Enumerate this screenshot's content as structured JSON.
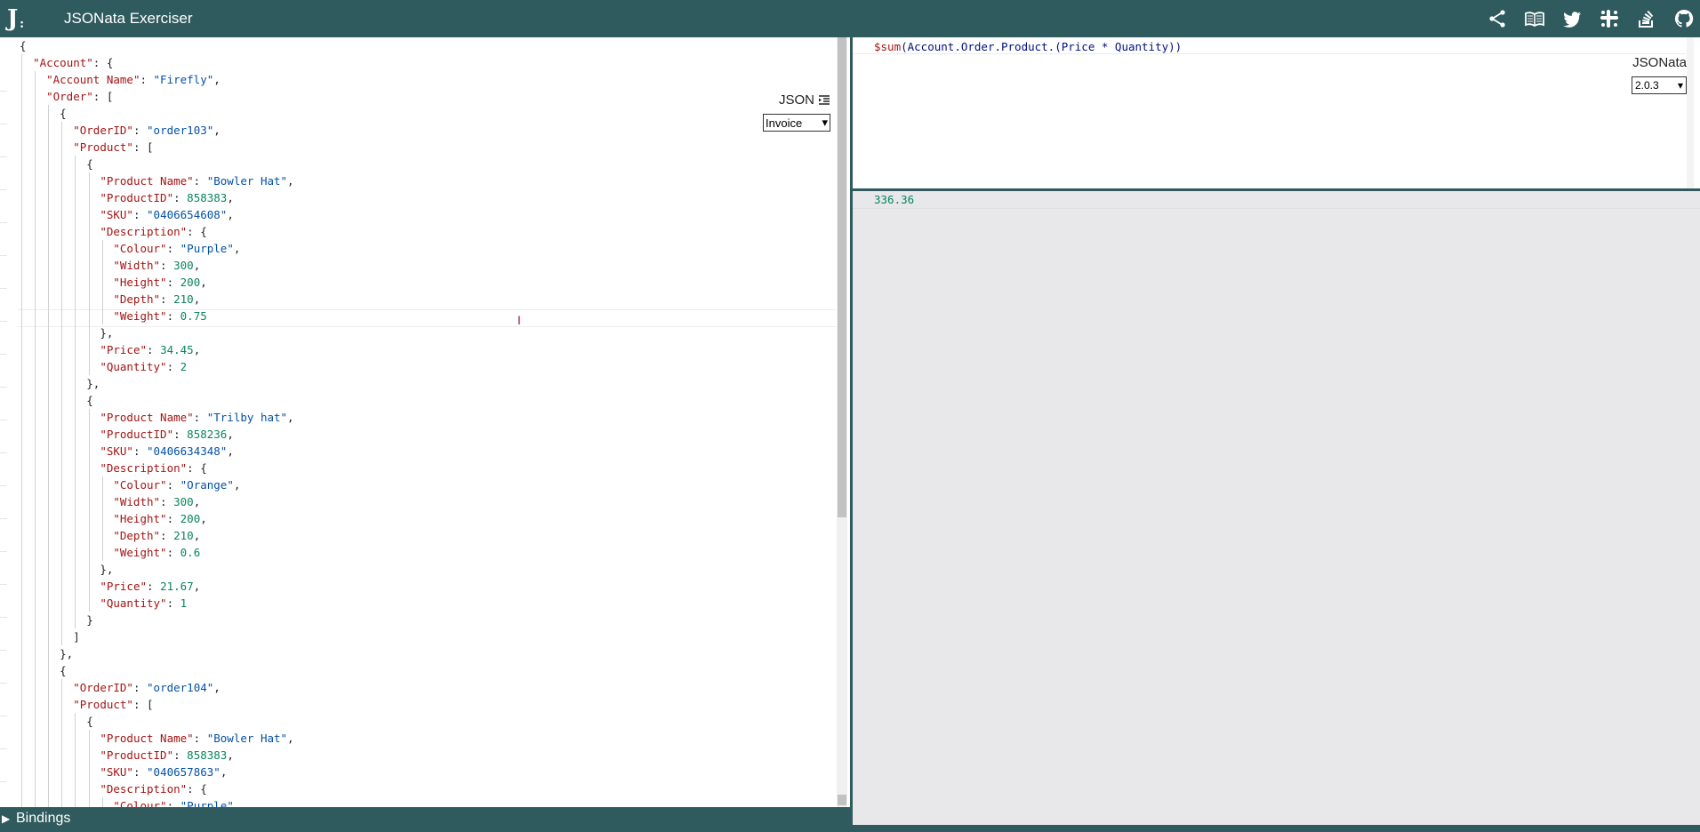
{
  "header": {
    "title": "JSONata Exerciser",
    "logo_letter": "J",
    "icons": [
      "share-icon",
      "book-icon",
      "twitter-icon",
      "slack-icon",
      "stackoverflow-icon",
      "github-icon"
    ]
  },
  "left_panel": {
    "label": "JSON",
    "sample_selected": "Invoice",
    "lines": [
      "{",
      "  \"Account\": {",
      "    \"Account Name\": \"Firefly\",",
      "    \"Order\": [",
      "      {",
      "        \"OrderID\": \"order103\",",
      "        \"Product\": [",
      "          {",
      "            \"Product Name\": \"Bowler Hat\",",
      "            \"ProductID\": 858383,",
      "            \"SKU\": \"0406654608\",",
      "            \"Description\": {",
      "              \"Colour\": \"Purple\",",
      "              \"Width\": 300,",
      "              \"Height\": 200,",
      "              \"Depth\": 210,",
      "              \"Weight\": 0.75",
      "            },",
      "            \"Price\": 34.45,",
      "            \"Quantity\": 2",
      "          },",
      "          {",
      "            \"Product Name\": \"Trilby hat\",",
      "            \"ProductID\": 858236,",
      "            \"SKU\": \"0406634348\",",
      "            \"Description\": {",
      "              \"Colour\": \"Orange\",",
      "              \"Width\": 300,",
      "              \"Height\": 200,",
      "              \"Depth\": 210,",
      "              \"Weight\": 0.6",
      "            },",
      "            \"Price\": 21.67,",
      "            \"Quantity\": 1",
      "          }",
      "        ]",
      "      },",
      "      {",
      "        \"OrderID\": \"order104\",",
      "        \"Product\": [",
      "          {",
      "            \"Product Name\": \"Bowler Hat\",",
      "            \"ProductID\": 858383,",
      "            \"SKU\": \"040657863\",",
      "            \"Description\": {",
      "              \"Colour\": \"Purple\","
    ]
  },
  "expression": {
    "fn": "$sum",
    "rest": "(Account.Order.Product.(Price * Quantity))",
    "label": "JSONata",
    "version_selected": "2.0.3"
  },
  "result": {
    "value": "336.36"
  },
  "bindings": {
    "label": "Bindings"
  },
  "colors": {
    "header_bg": "#2f5a5e",
    "result_bg": "#e8e7ea",
    "key": "#a31515",
    "string": "#0451a5",
    "number": "#098658"
  }
}
